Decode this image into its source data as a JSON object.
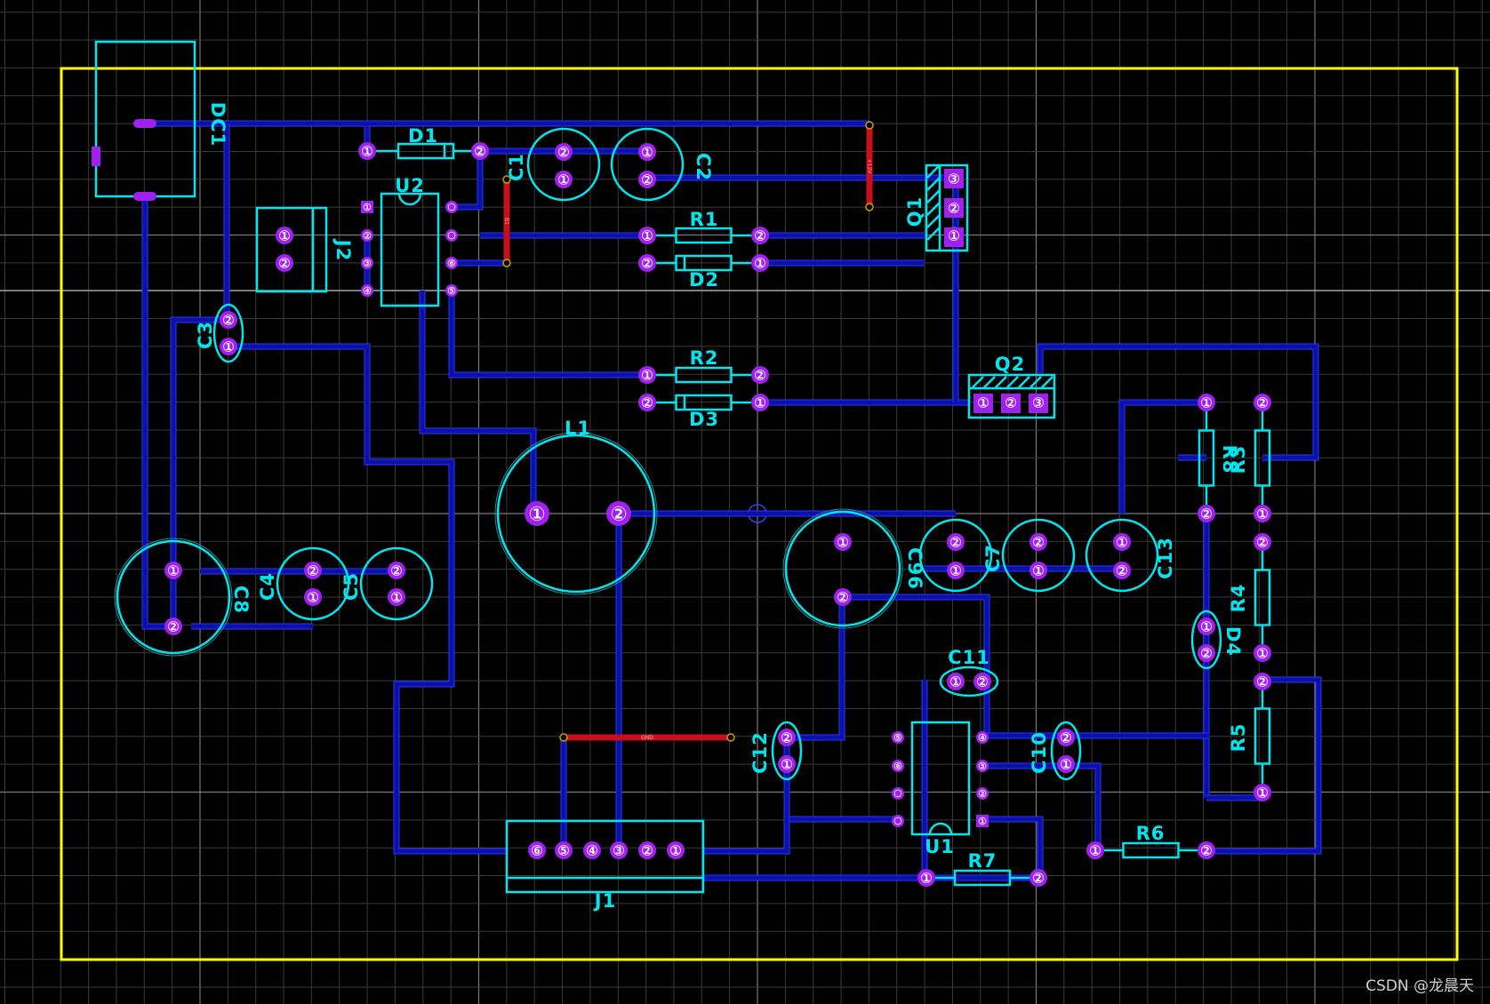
{
  "watermark": "CSDN @龙晨天",
  "colors": {
    "background": "#000000",
    "grid_fine": "#3a3a3a",
    "grid_major": "#7a7a7a",
    "grid_axis": "#bfbfbf",
    "outline": "#ffff00",
    "silk": "#00e5ee",
    "trace": "#0a10a8",
    "trace_edge": "#2a36ff",
    "pad": "#a020f0",
    "jumper": "#c8101a"
  },
  "components": {
    "DC1": "DC1",
    "D1": "D1",
    "U2": "U2",
    "C1": "C1",
    "C2": "C2",
    "Q1": "Q1",
    "J2": "J2",
    "R1": "R1",
    "D2": "D2",
    "C3": "C3",
    "R2": "R2",
    "D3": "D3",
    "Q2": "Q2",
    "L1": "L1",
    "R8": "R8",
    "R3": "R3",
    "C8": "C8",
    "C4": "C4",
    "C5": "C5",
    "C9": "C96",
    "C6": "",
    "C7": "C7",
    "C13": "C13",
    "R4": "R4",
    "D4": "D4",
    "C11": "C11",
    "R5": "R5",
    "C12": "C12",
    "C10": "C10",
    "U1": "U1",
    "R6": "R6",
    "R7": "R7",
    "J1": "J1"
  },
  "pads": {
    "one": "1",
    "two": "2",
    "three": "3",
    "four": "4",
    "five": "5",
    "six": "6"
  },
  "jumpers": {
    "plus12v": "+12V",
    "net_a": "B1",
    "gnd": "GND"
  }
}
